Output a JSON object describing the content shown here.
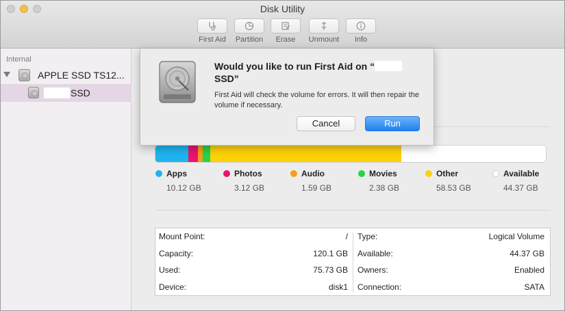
{
  "window": {
    "title": "Disk Utility"
  },
  "toolbar": {
    "items": [
      {
        "label": "First Aid",
        "icon": "stethoscope-icon"
      },
      {
        "label": "Partition",
        "icon": "partition-icon"
      },
      {
        "label": "Erase",
        "icon": "erase-icon"
      },
      {
        "label": "Unmount",
        "icon": "unmount-icon"
      },
      {
        "label": "Info",
        "icon": "info-icon"
      }
    ]
  },
  "sidebar": {
    "section_title": "Internal",
    "disk": {
      "label": "APPLE SSD TS12...",
      "icon": "hard-drive-icon"
    },
    "volume": {
      "label": "SSD",
      "icon": "volume-icon"
    }
  },
  "dialog": {
    "title_prefix": "Would you like to run First Aid on “",
    "title_suffix": "SSD”",
    "message": "First Aid will check the volume for errors. It will then repair the volume if necessary.",
    "cancel_label": "Cancel",
    "run_label": "Run",
    "icon": "hard-drive-icon"
  },
  "storage": {
    "categories": [
      {
        "name": "Apps",
        "size": "10.12 GB",
        "color": "#1eb4f0"
      },
      {
        "name": "Photos",
        "size": "3.12 GB",
        "color": "#e8146e"
      },
      {
        "name": "Audio",
        "size": "1.59 GB",
        "color": "#f59e18"
      },
      {
        "name": "Movies",
        "size": "2.38 GB",
        "color": "#28d24a"
      },
      {
        "name": "Other",
        "size": "58.53 GB",
        "color": "#fdd208"
      },
      {
        "name": "Available",
        "size": "44.37 GB",
        "color": "#ffffff"
      }
    ]
  },
  "info": {
    "left": [
      {
        "key": "Mount Point:",
        "value": "/"
      },
      {
        "key": "Capacity:",
        "value": "120.1 GB"
      },
      {
        "key": "Used:",
        "value": "75.73 GB"
      },
      {
        "key": "Device:",
        "value": "disk1"
      }
    ],
    "right": [
      {
        "key": "Type:",
        "value": "Logical Volume"
      },
      {
        "key": "Available:",
        "value": "44.37 GB"
      },
      {
        "key": "Owners:",
        "value": "Enabled"
      },
      {
        "key": "Connection:",
        "value": "SATA"
      }
    ]
  }
}
